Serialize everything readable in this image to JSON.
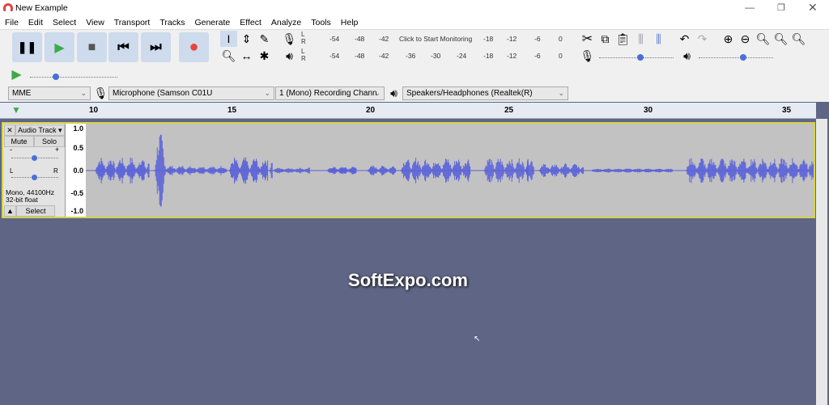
{
  "window": {
    "title": "New Example",
    "controls": [
      "minimize",
      "restore",
      "close"
    ]
  },
  "menu": [
    "File",
    "Edit",
    "Select",
    "View",
    "Transport",
    "Tracks",
    "Generate",
    "Effect",
    "Analyze",
    "Tools",
    "Help"
  ],
  "transport": [
    "pause",
    "play",
    "stop",
    "skip-start",
    "skip-end",
    "record"
  ],
  "record_meter": {
    "ticks": [
      "-54",
      "-48",
      "-42",
      "-18",
      "-12",
      "-6",
      "0"
    ],
    "prompt": "Click to Start Monitoring"
  },
  "play_meter": {
    "ticks": [
      "-54",
      "-48",
      "-42",
      "-36",
      "-30",
      "-24",
      "-18",
      "-12",
      "-6",
      "0"
    ]
  },
  "devices": {
    "host": "MME",
    "input": "Microphone (Samson C01U",
    "channels": "1 (Mono) Recording Chann",
    "output": "Speakers/Headphones (Realtek(R)"
  },
  "sliders": {
    "play_speed": 0.3,
    "rec_volume": 0.55,
    "play_volume": 0.6
  },
  "ruler": [
    "10",
    "15",
    "20",
    "25",
    "30",
    "35"
  ],
  "track": {
    "name": "Audio Track",
    "mute": "Mute",
    "solo": "Solo",
    "gain_minus": "-",
    "gain_plus": "+",
    "pan_l": "L",
    "pan_r": "R",
    "gain": 0.5,
    "pan": 0.5,
    "info1": "Mono, 44100Hz",
    "info2": "32-bit float",
    "select": "Select",
    "scale": [
      "1.0",
      "0.5",
      "0.0",
      "-0.5",
      "-1.0"
    ],
    "waveform_envelope": [
      [
        10.06,
        12.0,
        0.3
      ],
      [
        12.2,
        12.6,
        0.9
      ],
      [
        12.6,
        14.8,
        0.1
      ],
      [
        14.9,
        16.3,
        0.3
      ],
      [
        16.35,
        16.45,
        0.5
      ],
      [
        16.5,
        17.8,
        0.05
      ],
      [
        18.45,
        19.5,
        0.08
      ],
      [
        19.9,
        20.9,
        0.1
      ],
      [
        21.1,
        23.6,
        0.3
      ],
      [
        24.1,
        25.9,
        0.3
      ],
      [
        25.6,
        25.7,
        0.65
      ],
      [
        26.1,
        27.7,
        0.15
      ],
      [
        28.0,
        30.9,
        0.03
      ],
      [
        31.4,
        36.0,
        0.3
      ]
    ]
  },
  "watermark": "SoftExpo.com",
  "colors": {
    "wave": "#5b63d8",
    "track_border": "#d6d24a",
    "record": "#e8443a",
    "play": "#3daa4a"
  }
}
